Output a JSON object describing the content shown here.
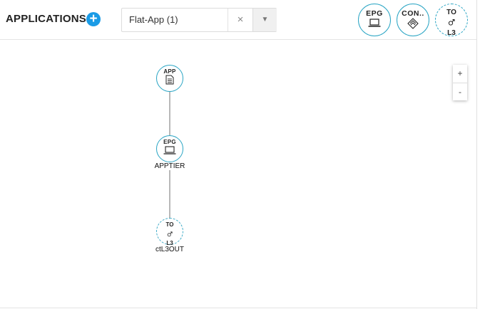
{
  "header": {
    "title": "APPLICATIONS",
    "add_symbol": "+",
    "selector": {
      "value": "Flat-App (1)",
      "clear_symbol": "×",
      "arrow_symbol": "▼"
    }
  },
  "palette": [
    {
      "label": "EPG",
      "icon": "laptop-icon"
    },
    {
      "label": "CON..",
      "icon": "handshake-icon"
    },
    {
      "label_top": "TO",
      "label_bottom": "L3",
      "icon": "external-l3-icon"
    }
  ],
  "graph": {
    "nodes": [
      {
        "badge": "APP",
        "icon": "document-icon",
        "caption": ""
      },
      {
        "badge": "EPG",
        "icon": "laptop-icon",
        "caption": "APPTIER"
      },
      {
        "badge_top": "TO",
        "badge_bottom": "L3",
        "icon": "external-l3-icon",
        "caption": "ctL3OUT"
      }
    ]
  },
  "zoom": {
    "in": "+",
    "out": "-"
  },
  "colors": {
    "accent": "#1a9be6",
    "node_border": "#2aa5c4"
  }
}
